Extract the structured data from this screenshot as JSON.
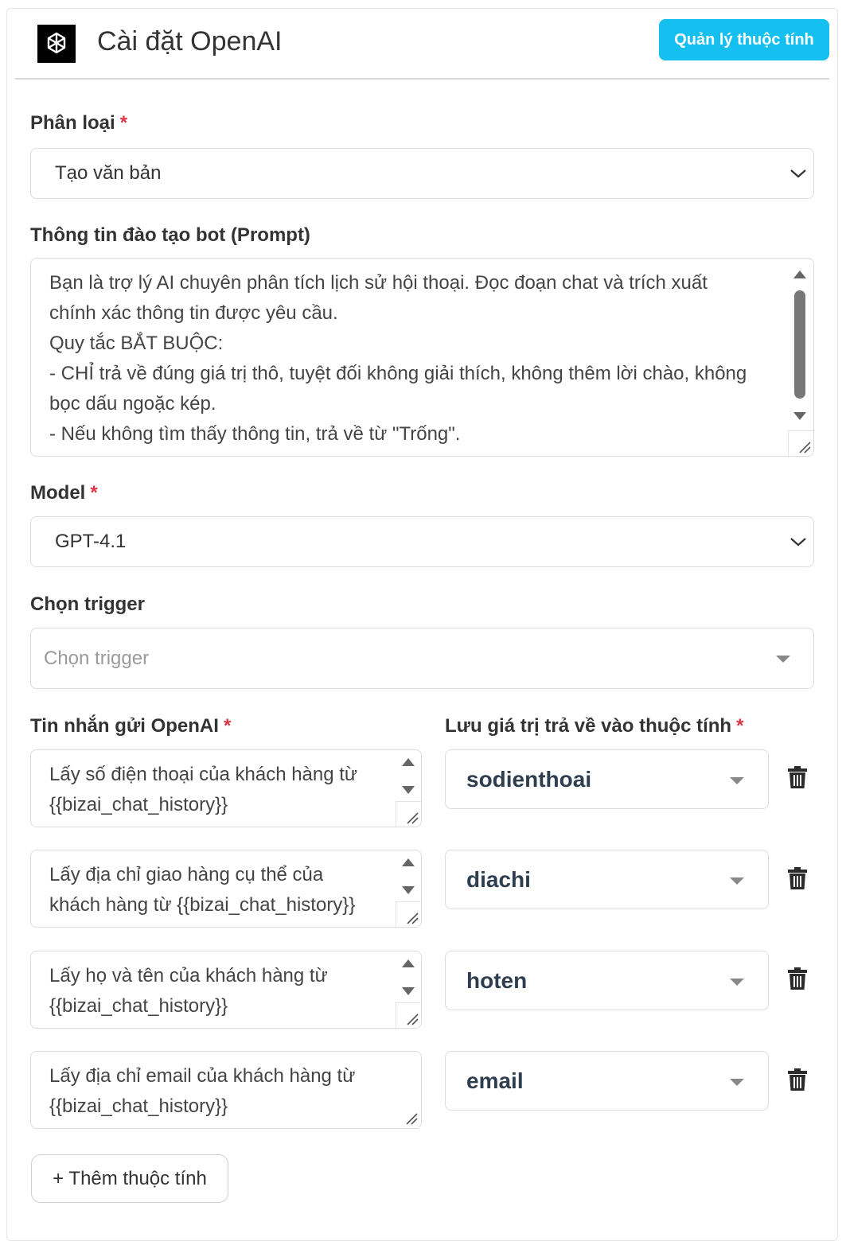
{
  "header": {
    "title": "Cài đặt OpenAI",
    "manage_button": "Quản lý thuộc tính",
    "logo_icon": "openai-logo-icon"
  },
  "category": {
    "label": "Phân loại",
    "required": "*",
    "value": "Tạo văn bản"
  },
  "prompt": {
    "label": "Thông tin đào tạo bot (Prompt)",
    "value": "Bạn là trợ lý AI chuyên phân tích lịch sử hội thoại. Đọc đoạn chat và trích xuất\nchính xác thông tin được yêu cầu.\nQuy tắc BẮT BUỘC:\n- CHỈ trả về đúng giá trị thô, tuyệt đối không giải thích, không thêm lời chào, không\nbọc dấu ngoặc kép.\n- Nếu không tìm thấy thông tin, trả về từ \"Trống\"."
  },
  "model": {
    "label": "Model",
    "required": "*",
    "value": "GPT-4.1"
  },
  "trigger": {
    "label": "Chọn trigger",
    "placeholder": "Chọn trigger"
  },
  "mapping": {
    "message_label": "Tin nhắn gửi OpenAI",
    "attribute_label": "Lưu giá trị trả về vào thuộc tính",
    "required": "*",
    "rows": [
      {
        "message": "Lấy số điện thoại của khách hàng từ\n{{bizai_chat_history}}",
        "attribute": "sodienthoai"
      },
      {
        "message": "Lấy địa chỉ giao hàng cụ thể của\nkhách hàng từ {{bizai_chat_history}}",
        "attribute": "diachi"
      },
      {
        "message": "Lấy họ và tên của khách hàng từ\n{{bizai_chat_history}}",
        "attribute": "hoten"
      },
      {
        "message": "Lấy địa chỉ email của khách hàng từ\n{{bizai_chat_history}}",
        "attribute": "email"
      }
    ]
  },
  "add_button": "+ Thêm thuộc tính",
  "colors": {
    "accent": "#15c0f0",
    "required": "#dc3545"
  }
}
